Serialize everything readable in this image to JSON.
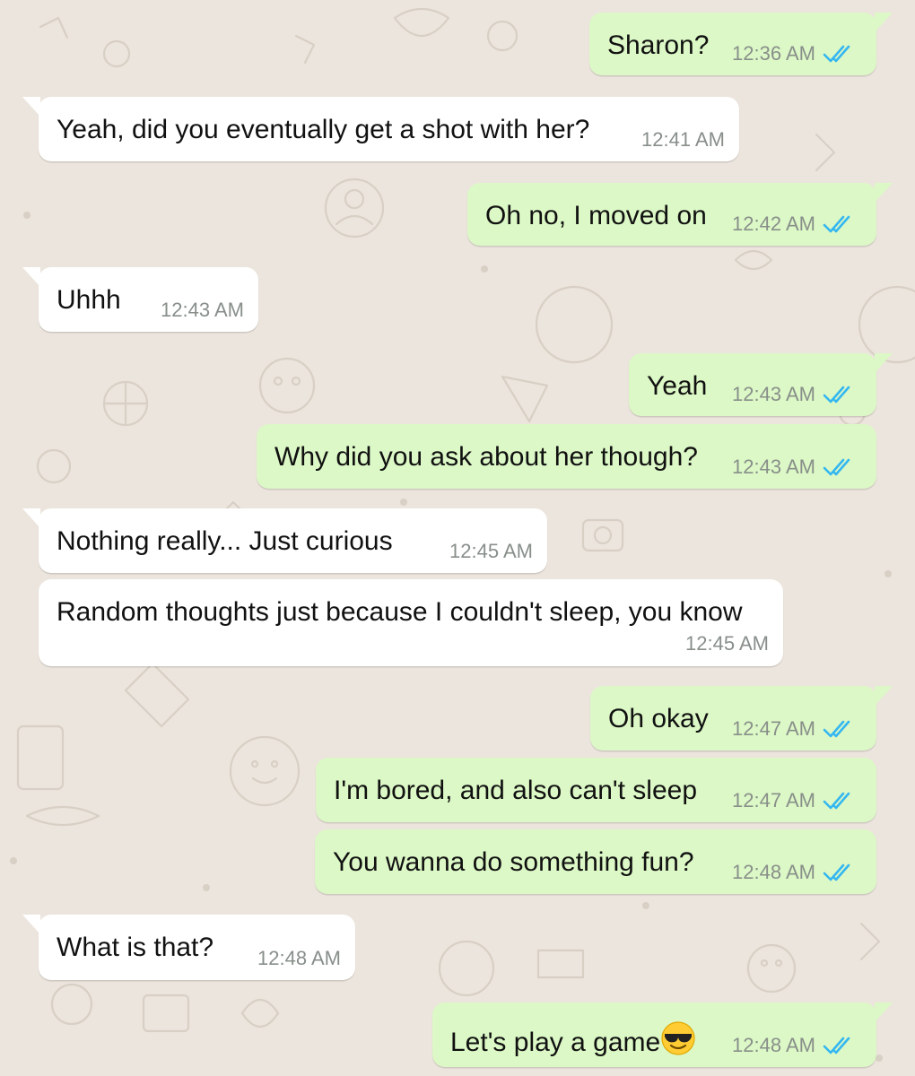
{
  "colors": {
    "outgoing_bubble": "#dcf8c6",
    "incoming_bubble": "#ffffff",
    "background": "#ece5dd",
    "read_ticks": "#34b7f1"
  },
  "messages": [
    {
      "direction": "outgoing",
      "text": "Sharon?",
      "time": "12:36 AM",
      "status": "read"
    },
    {
      "direction": "incoming",
      "text": "Yeah, did you eventually get a shot with her?",
      "time": "12:41 AM"
    },
    {
      "direction": "outgoing",
      "text": "Oh no, I moved on",
      "time": "12:42 AM",
      "status": "read"
    },
    {
      "direction": "incoming",
      "text": "Uhhh",
      "time": "12:43 AM"
    },
    {
      "direction": "outgoing",
      "text": "Yeah",
      "time": "12:43 AM",
      "status": "read"
    },
    {
      "direction": "outgoing",
      "text": "Why did you ask about her though?",
      "time": "12:43 AM",
      "status": "read"
    },
    {
      "direction": "incoming",
      "text": "Nothing really... Just curious",
      "time": "12:45 AM"
    },
    {
      "direction": "incoming",
      "text": "Random thoughts just because I couldn't sleep, you know",
      "time": "12:45 AM"
    },
    {
      "direction": "outgoing",
      "text": "Oh okay",
      "time": "12:47 AM",
      "status": "read"
    },
    {
      "direction": "outgoing",
      "text": "I'm bored, and also can't sleep",
      "time": "12:47 AM",
      "status": "read"
    },
    {
      "direction": "outgoing",
      "text": "You wanna do something fun?",
      "time": "12:48 AM",
      "status": "read"
    },
    {
      "direction": "incoming",
      "text": "What is that?",
      "time": "12:48 AM"
    },
    {
      "direction": "outgoing",
      "text": "Let's play a game",
      "time": "12:48 AM",
      "status": "read",
      "emoji": "smiling-face-with-sunglasses"
    }
  ]
}
